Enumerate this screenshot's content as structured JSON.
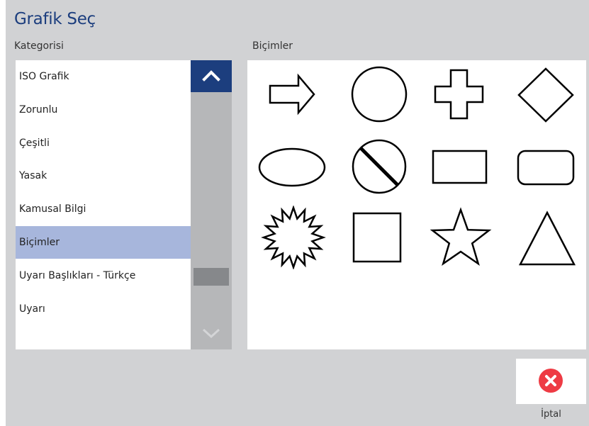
{
  "dialog": {
    "title": "Grafik Seç"
  },
  "category_panel": {
    "label": "Kategorisi",
    "items": [
      {
        "label": "ISO Grafik",
        "selected": false
      },
      {
        "label": "Zorunlu",
        "selected": false
      },
      {
        "label": "Çeşitli",
        "selected": false
      },
      {
        "label": "Yasak",
        "selected": false
      },
      {
        "label": "Kamusal Bilgi",
        "selected": false
      },
      {
        "label": "Biçimler",
        "selected": true
      },
      {
        "label": "Uyarı Başlıkları - Türkçe",
        "selected": false
      },
      {
        "label": "Uyarı",
        "selected": false
      }
    ]
  },
  "shapes_panel": {
    "label": "Biçimler",
    "shapes": [
      "arrow-right-icon",
      "circle-icon",
      "cross-icon",
      "diamond-icon",
      "ellipse-icon",
      "prohibition-circle-icon",
      "rectangle-icon",
      "rounded-rectangle-icon",
      "starburst-icon",
      "square-icon",
      "star-icon",
      "triangle-icon"
    ]
  },
  "actions": {
    "cancel_label": "İptal"
  },
  "colors": {
    "background": "#d1d2d4",
    "title": "#1c3e7e",
    "selected_row": "#a7b6dc",
    "scroll_up": "#1c3e7e",
    "cancel_icon": "#ee3b44"
  }
}
